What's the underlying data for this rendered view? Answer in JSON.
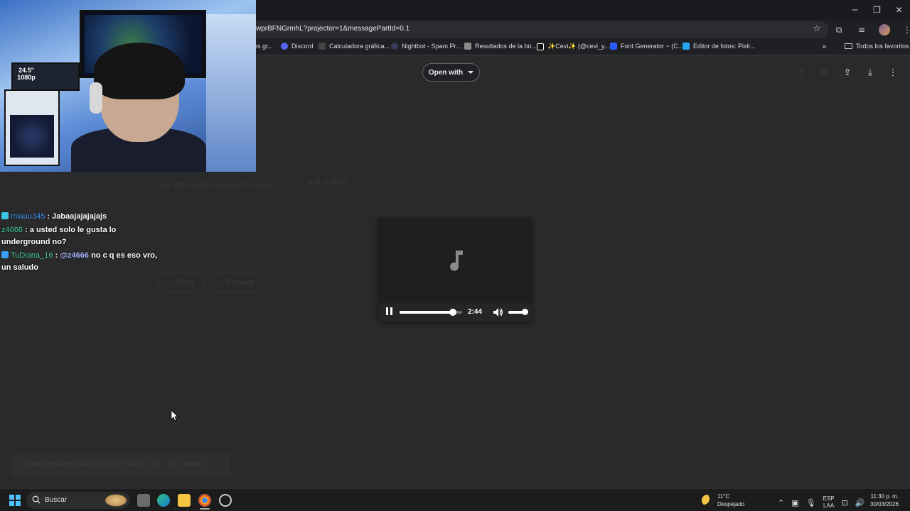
{
  "browser": {
    "url": "wprBFNGrmhL?projector=1&messagePartId=0.1",
    "window_controls": {
      "minimize": "─",
      "restore": "❐",
      "close": "✕"
    },
    "bookmarks": [
      {
        "label": "os gr...",
        "color": "#666666"
      },
      {
        "label": "Discord",
        "color": "#5865f2"
      },
      {
        "label": "Calculadora gráfica...",
        "color": "#444444"
      },
      {
        "label": "Nightbot - Spam Pr...",
        "color": "#3a3a5a"
      },
      {
        "label": "Resultados de la bú...",
        "color": "#8a8a8a"
      },
      {
        "label": "✨Cevi✨ (@cevi_y...",
        "color": "#111111"
      },
      {
        "label": "Font Generator ~ (C...",
        "color": "#2a5cff"
      },
      {
        "label": "Editor de fotos: Pixlr...",
        "color": "#25a7f0"
      }
    ],
    "bookmarks_folder": "Todos los favoritos"
  },
  "viewer": {
    "open_with_label": "Open with",
    "ghost_texts": {
      "attachment": "One attachment • Scanned by Gmail ⓘ",
      "add_drive": "Add to Drive",
      "reply": "Reply",
      "forward": "Forward",
      "toast_text": "Enable desktop notifications for Gmail.",
      "toast_ok": "OK",
      "toast_no": "No, thanks"
    }
  },
  "audio_player": {
    "time": "2:44",
    "progress": 0.85,
    "volume": 1.0
  },
  "chat": [
    {
      "user": "miauu345",
      "user_color": "#4a9df8",
      "badge": "#3ac6e8",
      "text": ": Jabaajajajajajs"
    },
    {
      "user": "z4666",
      "user_color": "#4ad4a4",
      "badge": "",
      "text": ": a usted solo le gusta lo underground no?"
    },
    {
      "user": "TuDiana_16",
      "user_color": "#4ad4a4",
      "badge": "#3a9df8",
      "mention": "@z4666",
      "text": "no c q es eso vro, un saludo"
    }
  ],
  "webcam": {
    "monitor_label": "24.5\" 1080p"
  },
  "taskbar": {
    "search_label": "Buscar",
    "weather_temp": "11°C",
    "weather_desc": "Despejado",
    "lang_top": "ESP",
    "lang_bottom": "LAA",
    "time": "11:30 p. m.",
    "date": "30/03/2026"
  }
}
